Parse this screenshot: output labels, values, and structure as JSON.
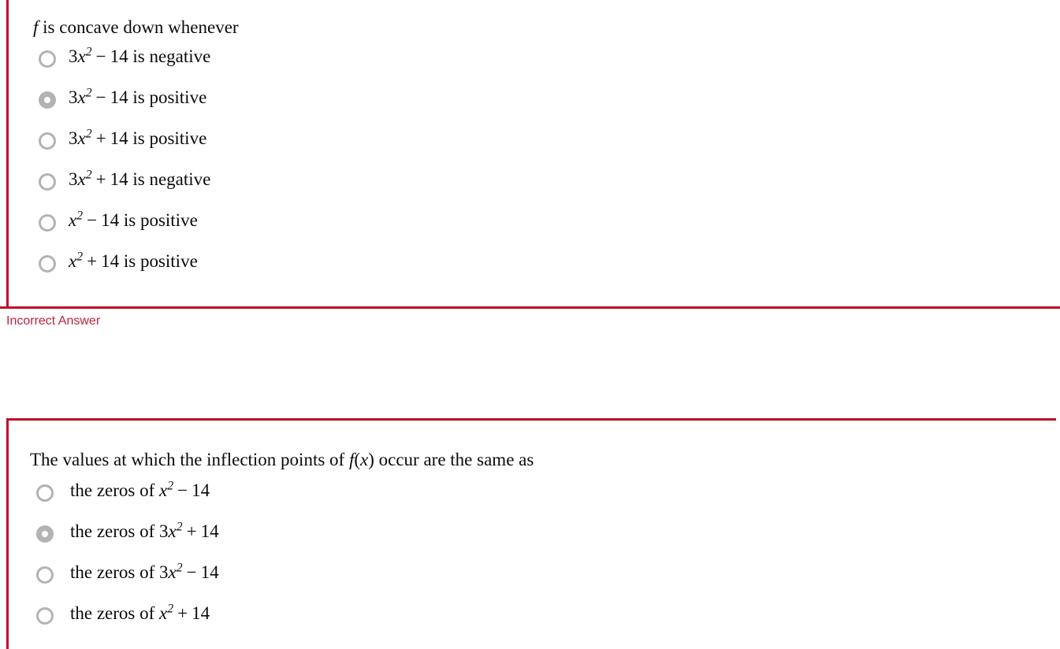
{
  "theme": {
    "block_border_color": "#bf0d26",
    "feedback_color": "#c5203c",
    "radio_color": "#b3b3b3",
    "text_color": "#0b0b0b",
    "background": "#ffffff"
  },
  "questions": [
    {
      "id": "q-concavity",
      "prompt_parts": [
        {
          "kind": "var",
          "text": "f"
        },
        {
          "kind": "text",
          "text": " is concave down whenever"
        }
      ],
      "prompt_plain": "f is concave down whenever",
      "selected_index": 1,
      "options": [
        {
          "plain": "3x² − 14 is negative",
          "parts": [
            {
              "kind": "text",
              "text": "3"
            },
            {
              "kind": "var",
              "text": "x"
            },
            {
              "kind": "sup",
              "text": "2"
            },
            {
              "kind": "op",
              "text": "−"
            },
            {
              "kind": "text",
              "text": "14 is negative"
            }
          ]
        },
        {
          "plain": "3x² − 14 is positive",
          "parts": [
            {
              "kind": "text",
              "text": "3"
            },
            {
              "kind": "var",
              "text": "x"
            },
            {
              "kind": "sup",
              "text": "2"
            },
            {
              "kind": "op",
              "text": "−"
            },
            {
              "kind": "text",
              "text": "14 is positive"
            }
          ]
        },
        {
          "plain": "3x² + 14 is positive",
          "parts": [
            {
              "kind": "text",
              "text": "3"
            },
            {
              "kind": "var",
              "text": "x"
            },
            {
              "kind": "sup",
              "text": "2"
            },
            {
              "kind": "op",
              "text": "+"
            },
            {
              "kind": "text",
              "text": "14 is positive"
            }
          ]
        },
        {
          "plain": "3x² + 14 is negative",
          "parts": [
            {
              "kind": "text",
              "text": "3"
            },
            {
              "kind": "var",
              "text": "x"
            },
            {
              "kind": "sup",
              "text": "2"
            },
            {
              "kind": "op",
              "text": "+"
            },
            {
              "kind": "text",
              "text": "14 is negative"
            }
          ]
        },
        {
          "plain": "x² − 14 is positive",
          "parts": [
            {
              "kind": "var",
              "text": "x"
            },
            {
              "kind": "sup",
              "text": "2"
            },
            {
              "kind": "op",
              "text": "−"
            },
            {
              "kind": "text",
              "text": "14 is positive"
            }
          ]
        },
        {
          "plain": "x² + 14 is positive",
          "parts": [
            {
              "kind": "var",
              "text": "x"
            },
            {
              "kind": "sup",
              "text": "2"
            },
            {
              "kind": "op",
              "text": "+"
            },
            {
              "kind": "text",
              "text": "14 is positive"
            }
          ]
        }
      ],
      "feedback": "Incorrect Answer"
    },
    {
      "id": "q-inflection-points",
      "prompt_parts": [
        {
          "kind": "text",
          "text": "The values at which the inflection points of "
        },
        {
          "kind": "var",
          "text": "f"
        },
        {
          "kind": "text",
          "text": "("
        },
        {
          "kind": "var",
          "text": "x"
        },
        {
          "kind": "text",
          "text": ") occur are the same as"
        }
      ],
      "prompt_plain": "The values at which the inflection points of f(x) occur are the same as",
      "selected_index": 1,
      "options": [
        {
          "plain": "the zeros of x² − 14",
          "parts": [
            {
              "kind": "text",
              "text": "the zeros of "
            },
            {
              "kind": "var",
              "text": "x"
            },
            {
              "kind": "sup",
              "text": "2"
            },
            {
              "kind": "op",
              "text": "−"
            },
            {
              "kind": "text",
              "text": "14"
            }
          ]
        },
        {
          "plain": "the zeros of 3x² + 14",
          "parts": [
            {
              "kind": "text",
              "text": "the zeros of 3"
            },
            {
              "kind": "var",
              "text": "x"
            },
            {
              "kind": "sup",
              "text": "2"
            },
            {
              "kind": "op",
              "text": "+"
            },
            {
              "kind": "text",
              "text": "14"
            }
          ]
        },
        {
          "plain": "the zeros of 3x² − 14",
          "parts": [
            {
              "kind": "text",
              "text": "the zeros of 3"
            },
            {
              "kind": "var",
              "text": "x"
            },
            {
              "kind": "sup",
              "text": "2"
            },
            {
              "kind": "op",
              "text": "−"
            },
            {
              "kind": "text",
              "text": "14"
            }
          ]
        },
        {
          "plain": "the zeros of x² + 14",
          "parts": [
            {
              "kind": "text",
              "text": "the zeros of "
            },
            {
              "kind": "var",
              "text": "x"
            },
            {
              "kind": "sup",
              "text": "2"
            },
            {
              "kind": "op",
              "text": "+"
            },
            {
              "kind": "text",
              "text": "14"
            }
          ]
        }
      ],
      "feedback": null
    }
  ]
}
